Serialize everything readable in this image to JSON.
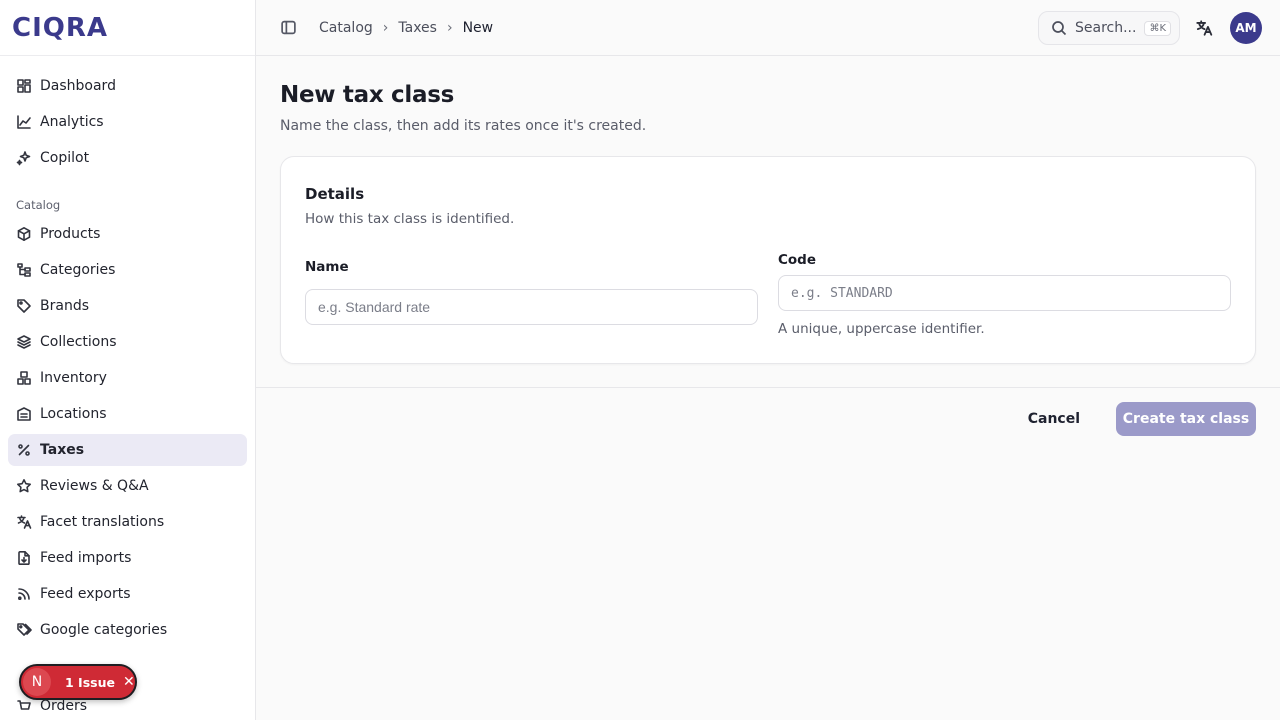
{
  "brand": {
    "logo": "CIQRA"
  },
  "sidebar": {
    "top_items": [
      {
        "label": "Dashboard",
        "icon": "dashboard-icon"
      },
      {
        "label": "Analytics",
        "icon": "analytics-icon"
      },
      {
        "label": "Copilot",
        "icon": "sparkles-icon"
      }
    ],
    "catalog_heading": "Catalog",
    "catalog_items": [
      {
        "label": "Products",
        "icon": "box-icon"
      },
      {
        "label": "Categories",
        "icon": "tree-icon"
      },
      {
        "label": "Brands",
        "icon": "tag-icon"
      },
      {
        "label": "Collections",
        "icon": "layers-icon"
      },
      {
        "label": "Inventory",
        "icon": "boxes-icon"
      },
      {
        "label": "Locations",
        "icon": "building-icon"
      },
      {
        "label": "Taxes",
        "icon": "percent-icon",
        "active": true
      },
      {
        "label": "Reviews & Q&A",
        "icon": "star-icon"
      },
      {
        "label": "Facet translations",
        "icon": "translate-icon"
      },
      {
        "label": "Feed imports",
        "icon": "file-import-icon"
      },
      {
        "label": "Feed exports",
        "icon": "rss-icon"
      },
      {
        "label": "Google categories",
        "icon": "tags-icon"
      }
    ],
    "bottom_items": [
      {
        "label": "Orders",
        "icon": "orders-icon"
      }
    ]
  },
  "topbar": {
    "breadcrumbs": [
      "Catalog",
      "Taxes",
      "New"
    ],
    "search_label": "Search...",
    "search_shortcut": "⌘K",
    "avatar_initials": "AM"
  },
  "main": {
    "title": "New tax class",
    "subtitle": "Name the class, then add its rates once it's created.",
    "card": {
      "title": "Details",
      "subtitle": "How this tax class is identified.",
      "name_label": "Name",
      "name_value": "",
      "name_placeholder": "e.g. Standard rate",
      "code_label": "Code",
      "code_value": "",
      "code_placeholder": "e.g. STANDARD",
      "code_hint": "A unique, uppercase identifier."
    },
    "cancel_label": "Cancel",
    "create_label": "Create tax class"
  },
  "issue_pill": {
    "badge": "N",
    "label": "1 Issue"
  },
  "colors": {
    "brand": "#3b3a8c",
    "active_bg": "#ebeaf5",
    "create_disabled": "#9b9ac9",
    "issue_red": "#cf2a35"
  }
}
